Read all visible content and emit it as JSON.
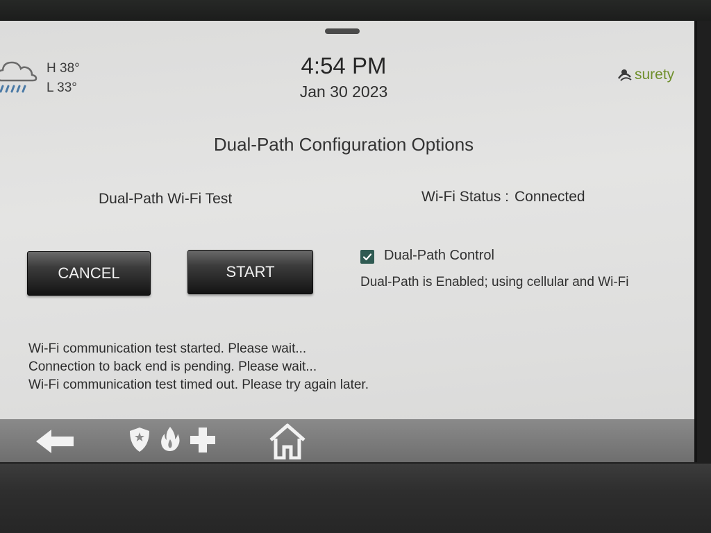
{
  "header": {
    "weather": {
      "icon": "rain-cloud-icon",
      "high": "H 38°",
      "low": "L 33°"
    },
    "time": "4:54 PM",
    "date": "Jan 30 2023",
    "brand": "surety"
  },
  "main": {
    "title": "Dual-Path Configuration Options",
    "wifi_test_label": "Dual-Path Wi-Fi Test",
    "wifi_status_label": "Wi-Fi Status :",
    "wifi_status_value": "Connected",
    "cancel_label": "CANCEL",
    "start_label": "START",
    "dual_path_control": {
      "label": "Dual-Path Control",
      "checked": true
    },
    "dual_path_description": "Dual-Path is Enabled; using cellular and Wi-Fi",
    "log_lines": [
      "Wi-Fi communication test started. Please wait...",
      "Connection to back end is pending. Please wait...",
      "Wi-Fi communication test timed out. Please try again later."
    ]
  },
  "nav": {
    "items": [
      "back-arrow-icon",
      "shield-icon",
      "fire-icon",
      "medical-cross-icon",
      "home-icon"
    ]
  },
  "colors": {
    "accent": "#6f8f2c",
    "checkbox": "#2f5a52",
    "nav_bar": "#7a7a7a",
    "button": "#2a2a2a"
  }
}
